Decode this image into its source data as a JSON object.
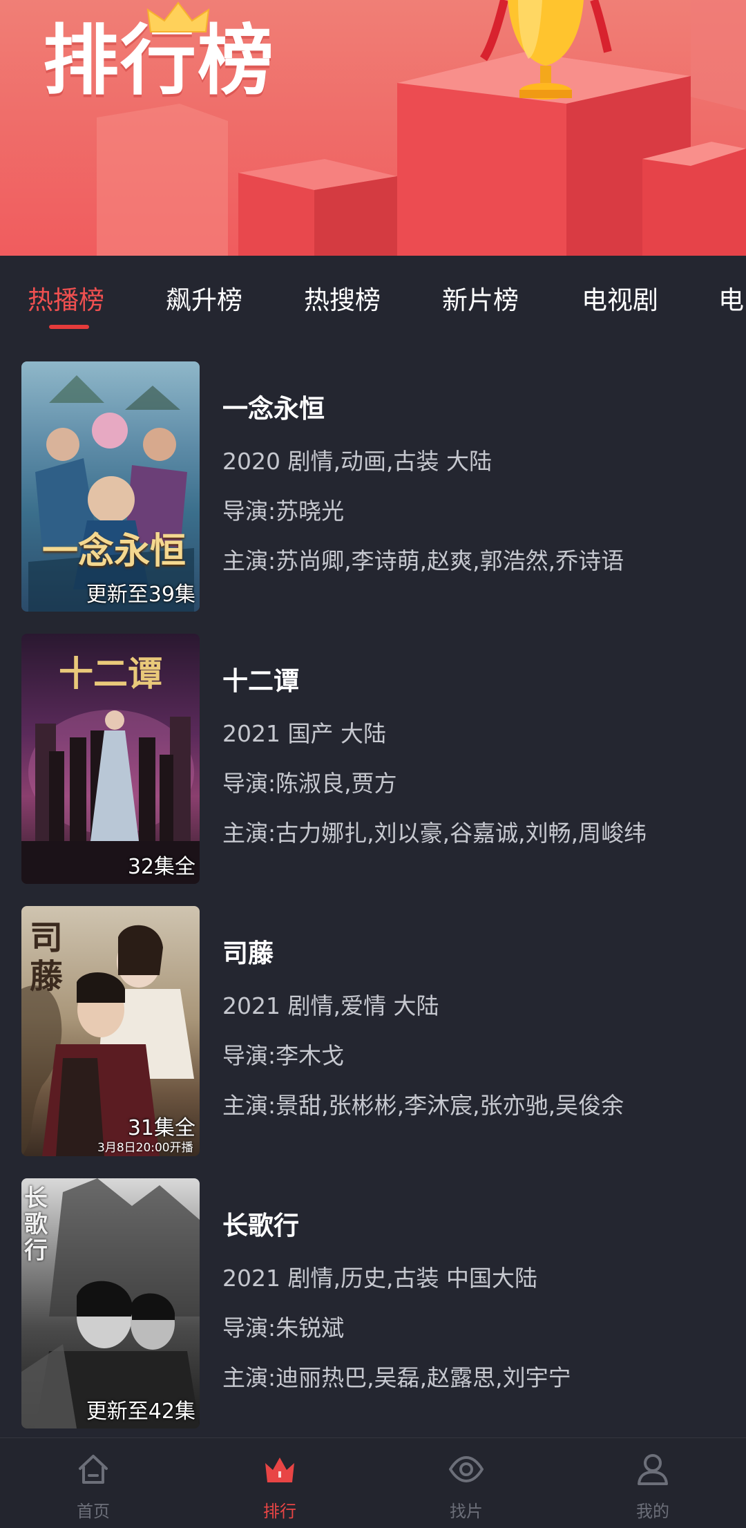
{
  "banner": {
    "title": "排行榜"
  },
  "tabs": [
    {
      "label": "热播榜",
      "active": true
    },
    {
      "label": "飙升榜",
      "active": false
    },
    {
      "label": "热搜榜",
      "active": false
    },
    {
      "label": "新片榜",
      "active": false
    },
    {
      "label": "电视剧",
      "active": false
    },
    {
      "label": "电",
      "active": false
    }
  ],
  "items": [
    {
      "title": "一念永恒",
      "meta": "2020 剧情,动画,古装 大陆",
      "director": "导演:苏晓光",
      "cast": "主演:苏尚卿,李诗萌,赵爽,郭浩然,乔诗语",
      "badge": "更新至39集",
      "poster_text": "一念永恒"
    },
    {
      "title": "十二谭",
      "meta": "2021 国产 大陆",
      "director": "导演:陈淑良,贾方",
      "cast": "主演:古力娜扎,刘以豪,谷嘉诚,刘畅,周峻纬",
      "badge": "32集全",
      "poster_text": "十二谭"
    },
    {
      "title": "司藤",
      "meta": "2021 剧情,爱情 大陆",
      "director": "导演:李木戈",
      "cast": "主演:景甜,张彬彬,李沐宸,张亦驰,吴俊余",
      "badge": "31集全",
      "poster_text": "司藤",
      "poster_sub": "3月8日20:00开播"
    },
    {
      "title": "长歌行",
      "meta": "2021 剧情,历史,古装 中国大陆",
      "director": "导演:朱锐斌",
      "cast": "主演:迪丽热巴,吴磊,赵露思,刘宇宁",
      "badge": "更新至42集",
      "poster_text": "长歌行"
    }
  ],
  "bottom_nav": [
    {
      "label": "首页",
      "icon": "home-icon",
      "active": false
    },
    {
      "label": "排行",
      "icon": "crown-icon",
      "active": true
    },
    {
      "label": "找片",
      "icon": "eye-icon",
      "active": false
    },
    {
      "label": "我的",
      "icon": "user-icon",
      "active": false
    }
  ],
  "colors": {
    "accent": "#e84545",
    "background": "#242630",
    "banner": "#ef6e6a"
  }
}
